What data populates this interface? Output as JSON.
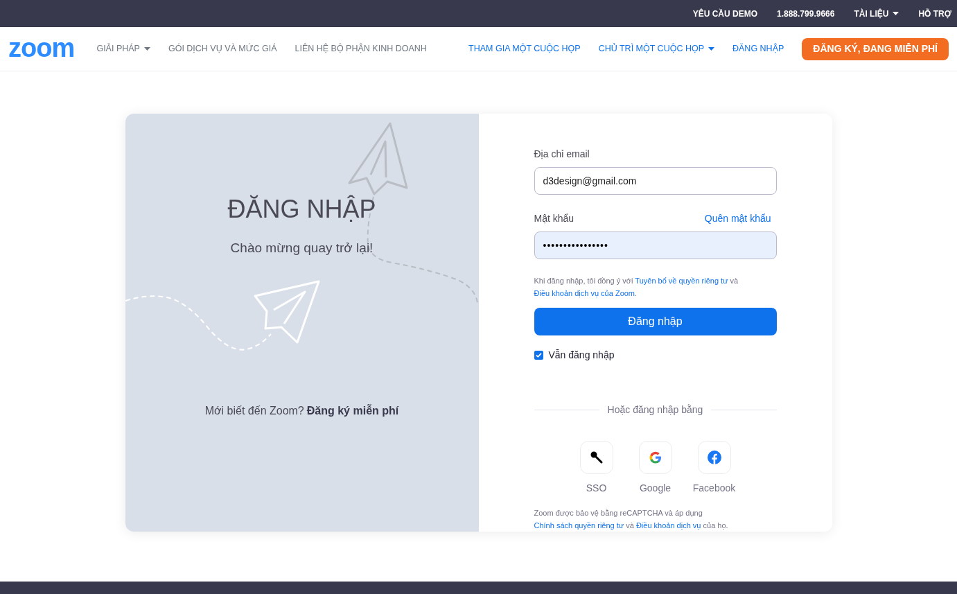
{
  "top_bar": {
    "links": [
      {
        "label": "YÊU CẦU DEMO",
        "dropdown": false
      },
      {
        "label": "1.888.799.9666",
        "dropdown": false
      },
      {
        "label": "TÀI LIỆU",
        "dropdown": true
      },
      {
        "label": "HỖ TRỢ",
        "dropdown": false
      }
    ]
  },
  "nav": {
    "logo": "zoom",
    "left_links": [
      {
        "label": "GIẢI PHÁP",
        "dropdown": true
      },
      {
        "label": "GÓI DỊCH VỤ VÀ MỨC GIÁ",
        "dropdown": false
      },
      {
        "label": "LIÊN HỆ BỘ PHẬN KINH DOANH",
        "dropdown": false
      }
    ],
    "right_links": [
      {
        "label": "THAM GIA MỘT CUỘC HỌP",
        "dropdown": false
      },
      {
        "label": "CHỦ TRÌ MỘT CUỘC HỌP",
        "dropdown": true
      },
      {
        "label": "ĐĂNG NHẬP",
        "dropdown": false
      }
    ],
    "cta": "ĐĂNG KÝ, ĐANG MIỄN PHÍ"
  },
  "left_panel": {
    "title": "ĐĂNG NHẬP",
    "subtitle": "Chào mừng quay trở lại!",
    "signup_prompt": "Mới biết đến Zoom?",
    "signup_link": "Đăng ký miễn phí"
  },
  "form": {
    "email_label": "Địa chỉ email",
    "email_value": "d3design@gmail.com",
    "password_label": "Mật khẩu",
    "forgot_link": "Quên mật khẩu",
    "password_value": "••••••••••••••••",
    "consent": [
      {
        "kind": "text",
        "text": "Khi đăng nhập, tôi đồng ý với "
      },
      {
        "kind": "link",
        "text": "Tuyên bố về quyền riêng tư"
      },
      {
        "kind": "text",
        "text": " và "
      },
      {
        "kind": "link",
        "text": "Điều khoản dịch vụ của Zoom"
      },
      {
        "kind": "text",
        "text": "."
      }
    ],
    "submit": "Đăng nhập",
    "remember": {
      "label": "Vẫn đăng nhập",
      "checked": true
    },
    "divider_text": "Hoặc đăng nhập bằng",
    "providers": [
      {
        "kind": "sso",
        "label": "SSO"
      },
      {
        "kind": "google",
        "label": "Google"
      },
      {
        "kind": "facebook",
        "label": "Facebook"
      }
    ],
    "recaptcha": [
      {
        "kind": "text",
        "text": "Zoom được bảo vệ bằng reCAPTCHA và áp dụng "
      },
      {
        "kind": "link",
        "text": "Chính sách quyền riêng tư"
      },
      {
        "kind": "text",
        "text": " và "
      },
      {
        "kind": "link",
        "text": "Điều khoản dịch vụ"
      },
      {
        "kind": "text",
        "text": " của họ."
      }
    ]
  }
}
